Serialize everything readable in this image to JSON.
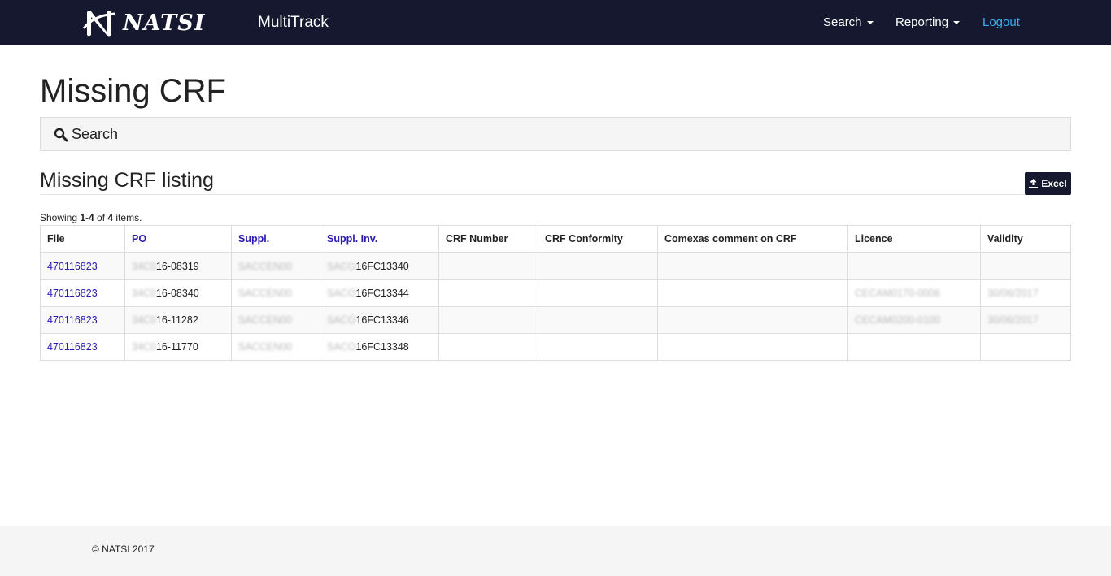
{
  "navbar": {
    "brand": "NATSI",
    "app_name": "MultiTrack",
    "search": "Search",
    "reporting": "Reporting",
    "logout": "Logout"
  },
  "page": {
    "title": "Missing CRF",
    "search_label": "Search",
    "listing_title": "Missing CRF listing",
    "excel_label": "Excel",
    "summary": {
      "prefix": "Showing ",
      "range": "1-4",
      "middle": " of ",
      "total": "4",
      "suffix": " items."
    }
  },
  "table": {
    "headers": [
      "File",
      "PO",
      "Suppl.",
      "Suppl. Inv.",
      "CRF Number",
      "CRF Conformity",
      "Comexas comment on CRF",
      "Licence",
      "Validity"
    ],
    "rows": [
      {
        "file": "470116823",
        "po_hidden": "34C0",
        "po": "16-08319",
        "suppl": "SACCEN00",
        "inv_hidden": "SACO",
        "inv": "16FC13340",
        "crf_number": "",
        "crf_conformity": "",
        "comment": "",
        "licence": "",
        "validity": ""
      },
      {
        "file": "470116823",
        "po_hidden": "34C0",
        "po": "16-08340",
        "suppl": "SACCEN00",
        "inv_hidden": "SACO",
        "inv": "16FC13344",
        "crf_number": "",
        "crf_conformity": "",
        "comment": "",
        "licence": "CECAM0170-0006",
        "validity": "30/06/2017"
      },
      {
        "file": "470116823",
        "po_hidden": "34C0",
        "po": "16-11282",
        "suppl": "SACCEN00",
        "inv_hidden": "SACO",
        "inv": "16FC13346",
        "crf_number": "",
        "crf_conformity": "",
        "comment": "",
        "licence": "CECAM0200-0100",
        "validity": "30/06/2017"
      },
      {
        "file": "470116823",
        "po_hidden": "34C0",
        "po": "16-11770",
        "suppl": "SACCEN00",
        "inv_hidden": "SACO",
        "inv": "16FC13348",
        "crf_number": "",
        "crf_conformity": "",
        "comment": "",
        "licence": "",
        "validity": ""
      }
    ]
  },
  "footer": {
    "copyright": "© NATSI 2017"
  },
  "colors": {
    "navbar_bg": "#15182e",
    "link": "#2a1ab0",
    "logout": "#3ab0f0"
  },
  "icons": {
    "search": "search-icon",
    "excel": "export-icon",
    "brand": "natsi-logo-icon"
  }
}
